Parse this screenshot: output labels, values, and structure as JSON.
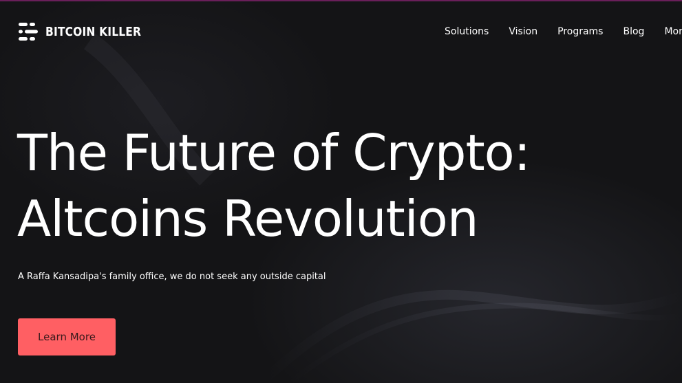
{
  "brand": {
    "name": "BITCOIN KILLER",
    "logo_icon": "bars-logo-icon"
  },
  "nav": {
    "items": [
      {
        "label": "Solutions"
      },
      {
        "label": "Vision"
      },
      {
        "label": "Programs"
      },
      {
        "label": "Blog"
      },
      {
        "label": "More"
      }
    ]
  },
  "hero": {
    "headline_line1": "The Future of Crypto:",
    "headline_line2": "Altcoins Revolution",
    "subtitle": "A Raffa Kansadipa's family office, we do not seek any outside capital",
    "cta_label": "Learn More"
  },
  "colors": {
    "background": "#141416",
    "accent": "#ff5f63",
    "top_border": "#6a1f5a",
    "text": "#ffffff"
  }
}
